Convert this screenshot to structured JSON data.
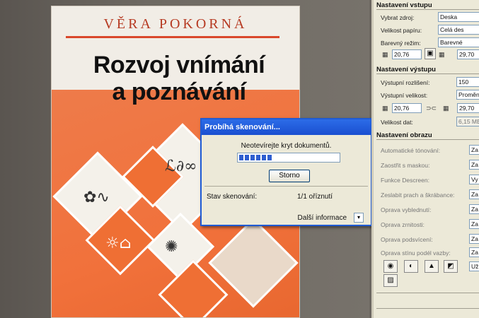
{
  "book": {
    "author": "VĚRA POKORNÁ",
    "title_line1": "Rozvoj vnímání",
    "title_line2": "a poznávání"
  },
  "dialog": {
    "title": "Probíhá skenování...",
    "message": "Neotevírejte kryt dokumentů.",
    "progress": 0.35,
    "stop_label": "Storno",
    "status_label": "Stav skenování:",
    "status_value": "1/1 oříznutí",
    "more_label": "Další informace"
  },
  "panel": {
    "input_header": "Nastavení vstupu",
    "source_label": "Vybrat zdroj:",
    "source_value": "Deska",
    "paper_label": "Velikost papíru:",
    "paper_value": "Celá des",
    "color_label": "Barevný režim:",
    "color_value": "Barevné",
    "input_w": "20,76",
    "input_h": "29,70",
    "output_header": "Nastavení výstupu",
    "resolution_label": "Výstupní rozlišení:",
    "resolution_value": "150",
    "outsize_label": "Výstupní velikost:",
    "outsize_value": "Proměn",
    "output_w": "20,76",
    "output_h": "29,70",
    "datasize_label": "Velikost dat:",
    "datasize_value": "6,15 MB",
    "image_header": "Nastavení obrazu",
    "image_rows": [
      {
        "label": "Automatické tónování:",
        "value": "Za"
      },
      {
        "label": "Zaostřit s maskou:",
        "value": "Za"
      },
      {
        "label": "Funkce Descreen:",
        "value": "Vy"
      },
      {
        "label": "Zeslabit prach a škrábance:",
        "value": "Za"
      },
      {
        "label": "Oprava vyblednutí:",
        "value": "Za"
      },
      {
        "label": "Oprava zrnitosti:",
        "value": "Za"
      },
      {
        "label": "Oprava podsvícení:",
        "value": "Za"
      },
      {
        "label": "Oprava stínu podél vazby:",
        "value": "Za"
      }
    ],
    "uz_value": "Už"
  }
}
